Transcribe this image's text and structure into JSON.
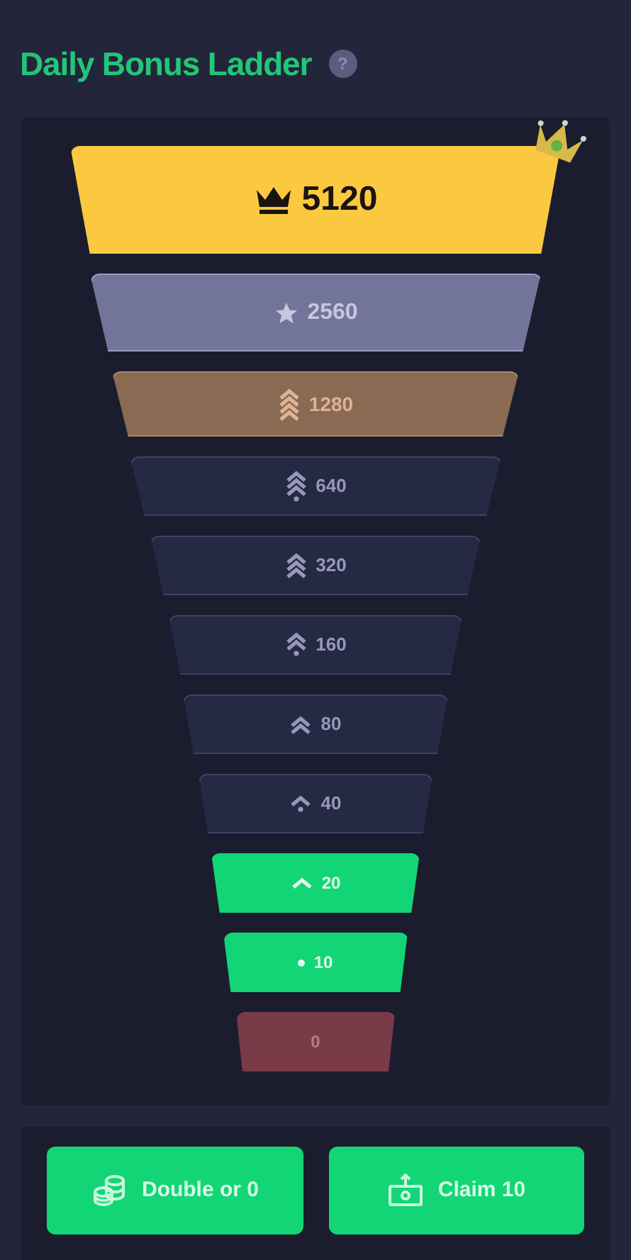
{
  "title": "Daily Bonus Ladder",
  "help_icon": "?",
  "rungs": [
    {
      "value": "5120",
      "kind": "top"
    },
    {
      "value": "2560",
      "kind": "silver"
    },
    {
      "value": "1280",
      "kind": "bronze"
    },
    {
      "value": "640",
      "kind": "locked"
    },
    {
      "value": "320",
      "kind": "locked"
    },
    {
      "value": "160",
      "kind": "locked"
    },
    {
      "value": "80",
      "kind": "locked"
    },
    {
      "value": "40",
      "kind": "locked"
    },
    {
      "value": "20",
      "kind": "reached"
    },
    {
      "value": "10",
      "kind": "reached"
    },
    {
      "value": "0",
      "kind": "lost"
    }
  ],
  "buttons": [
    {
      "label": "Double or 0"
    },
    {
      "label": "Claim 10"
    }
  ]
}
